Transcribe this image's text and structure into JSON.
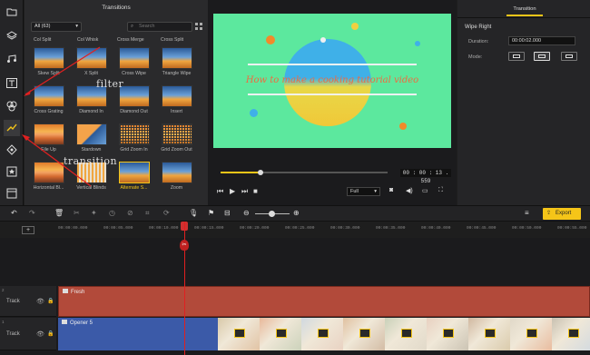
{
  "library": {
    "title": "Transitions",
    "category_select": "All (63)",
    "search_placeholder": "Search",
    "top_row": [
      "Col Split",
      "Col Whisk",
      "Cross Merge",
      "Cross Split"
    ],
    "tiles": [
      {
        "name": "Skew Split",
        "style": "sky"
      },
      {
        "name": "X Split",
        "style": "sky"
      },
      {
        "name": "Cross Wipe",
        "style": "sky"
      },
      {
        "name": "Triangle Wipe",
        "style": "sky"
      },
      {
        "name": "Cross Grating",
        "style": "sky"
      },
      {
        "name": "Diamond In",
        "style": "sky"
      },
      {
        "name": "Diamond Out",
        "style": "sky"
      },
      {
        "name": "Insert",
        "style": "sky"
      },
      {
        "name": "File Up",
        "style": "sunset"
      },
      {
        "name": "Stardown",
        "style": "mixed"
      },
      {
        "name": "Grid Zoom In",
        "style": "gridz"
      },
      {
        "name": "Grid Zoom Out",
        "style": "gridz"
      },
      {
        "name": "Horizontal Bl...",
        "style": "sunset"
      },
      {
        "name": "Vertical Blinds",
        "style": "blinds"
      },
      {
        "name": "Alternate S...",
        "style": "sky",
        "selected": true
      },
      {
        "name": "Zoom",
        "style": "sky"
      }
    ]
  },
  "annotations": {
    "filter": "filter",
    "transition": "transition"
  },
  "preview": {
    "video_title": "How to make a cooking tutorial video",
    "timecode": "00 : 00 : 13 . 559",
    "progress": 0.24,
    "zoom_select": "Full"
  },
  "properties": {
    "tab": "Transition",
    "name": "Wipe Right",
    "duration_label": "Duration:",
    "duration_value": "00:00:02.000",
    "mode_label": "Mode:"
  },
  "toolbar": {
    "export_label": "Export"
  },
  "ruler": {
    "ticks": [
      "00:00:00.000",
      "00:00:05.000",
      "00:00:10.000",
      "00:00:15.000",
      "00:00:20.000",
      "00:00:25.000",
      "00:00:30.000",
      "00:00:35.000",
      "00:00:40.000",
      "00:00:45.000",
      "00:00:50.000",
      "00:00:55.000"
    ]
  },
  "tracks": [
    {
      "number": "2",
      "label": "Track",
      "clip": "Fresh"
    },
    {
      "number": "1",
      "label": "Track",
      "clip": "Opener 5"
    }
  ],
  "colors": {
    "accent": "#f5c518",
    "playhead": "#e02020",
    "fresh_clip": "#b24a3a",
    "opener_clip": "#3b5aa8",
    "preview_bg": "#5ce89e"
  }
}
